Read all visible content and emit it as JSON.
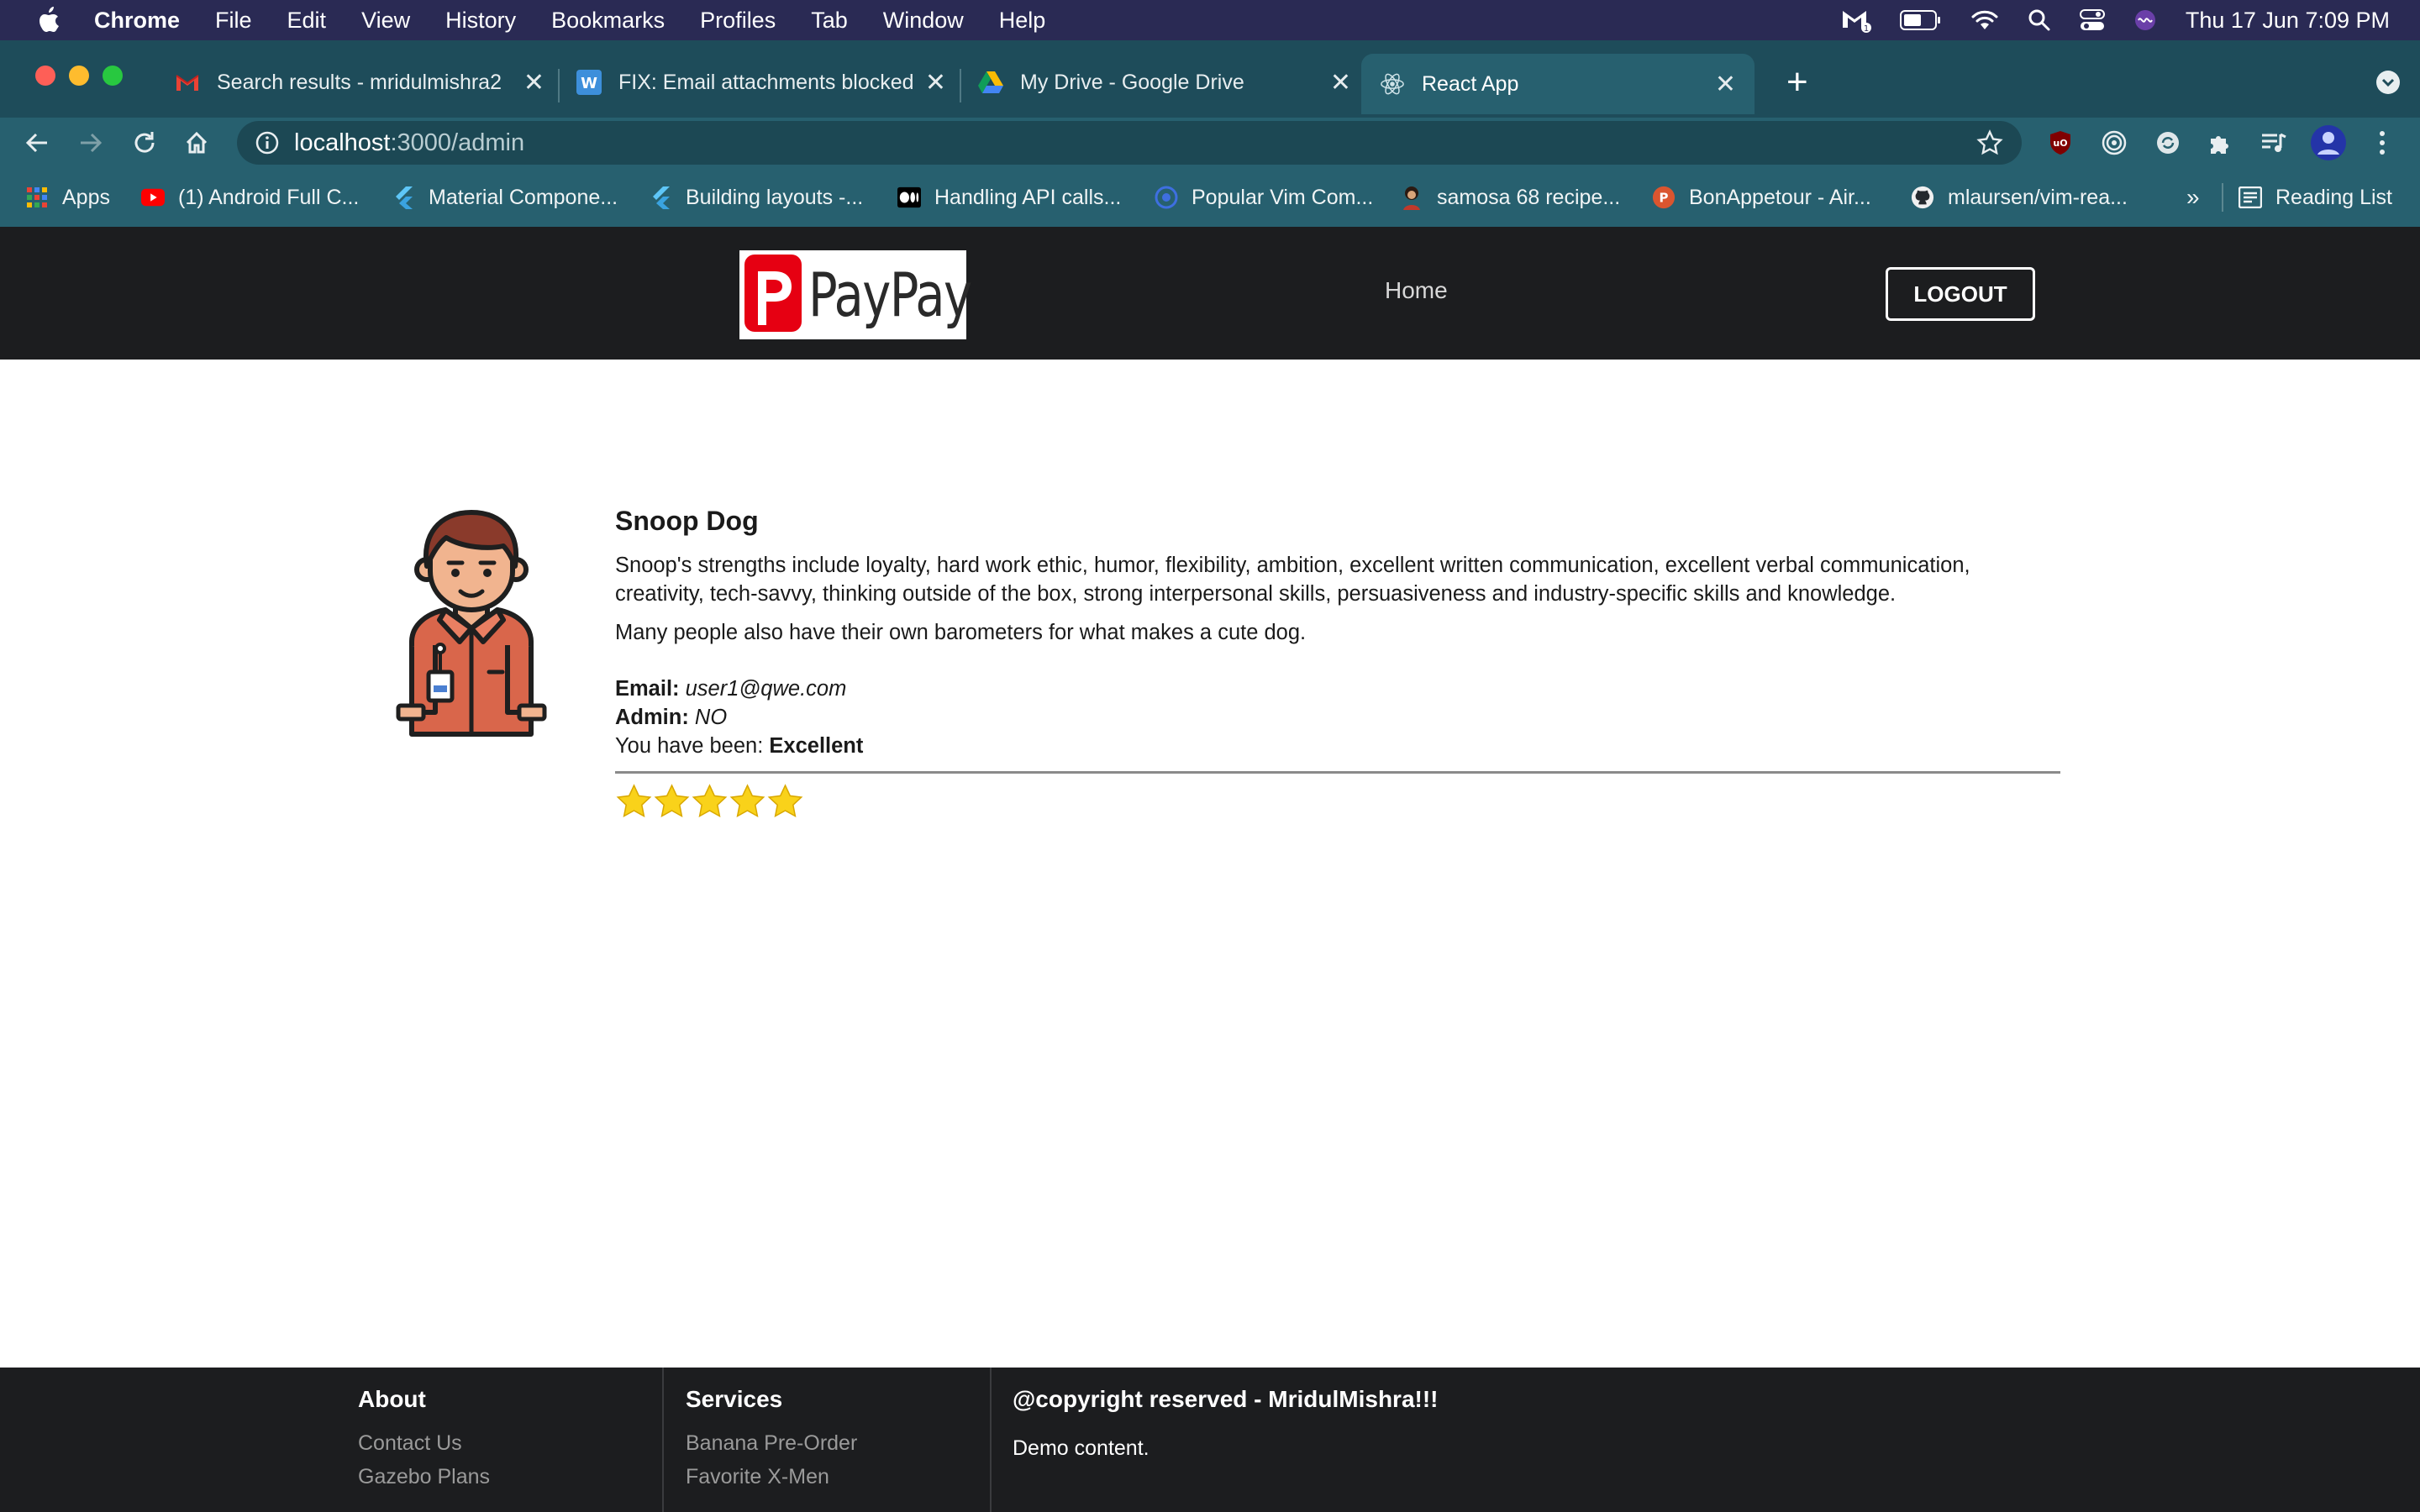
{
  "menubar": {
    "app_name": "Chrome",
    "items": [
      "File",
      "Edit",
      "View",
      "History",
      "Bookmarks",
      "Profiles",
      "Tab",
      "Window",
      "Help"
    ],
    "clock": "Thu 17 Jun  7:09 PM"
  },
  "tabs": [
    {
      "title": "Search results - mridulmishra2",
      "icon": "gmail-icon"
    },
    {
      "title": "FIX: Email attachments blocked",
      "icon": "windows-report-icon"
    },
    {
      "title": "My Drive - Google Drive",
      "icon": "google-drive-icon"
    },
    {
      "title": "React App",
      "icon": "react-icon",
      "active": true
    }
  ],
  "address_bar": {
    "host": "localhost",
    "path": ":3000/admin"
  },
  "bookmarks": {
    "apps_label": "Apps",
    "items": [
      {
        "label": "(1) Android Full C...",
        "icon": "youtube-icon"
      },
      {
        "label": "Material Compone...",
        "icon": "flutter-icon"
      },
      {
        "label": "Building layouts -...",
        "icon": "flutter-icon"
      },
      {
        "label": "Handling API calls...",
        "icon": "medium-icon"
      },
      {
        "label": "Popular Vim Com...",
        "icon": "vim-icon"
      },
      {
        "label": "samosa 68 recipe...",
        "icon": "recipe-icon"
      },
      {
        "label": "BonAppetour - Air...",
        "icon": "producthunt-icon"
      },
      {
        "label": "mlaursen/vim-rea...",
        "icon": "github-icon"
      }
    ],
    "overflow": "»",
    "reading_list": "Reading List"
  },
  "header": {
    "logo_text": "PayPay",
    "home_label": "Home",
    "logout_label": "LOGOUT"
  },
  "profile": {
    "name": "Snoop Dog",
    "strengths": "Snoop's strengths include loyalty, hard work ethic, humor, flexibility, ambition, excellent written communication, excellent verbal communication, creativity, tech-savvy, thinking outside of the box, strong interpersonal skills, persuasiveness and industry-specific skills and knowledge.",
    "note": "Many people also have their own barometers for what makes a cute dog.",
    "email_label": "Email:",
    "email": "user1@qwe.com",
    "admin_label": "Admin:",
    "admin": "NO",
    "rating_label": "You have been:",
    "rating_text": "Excellent",
    "stars": 5,
    "star_color": "#f9d21a"
  },
  "footer": {
    "about": {
      "heading": "About",
      "links": [
        "Contact Us",
        "Gazebo Plans"
      ]
    },
    "services": {
      "heading": "Services",
      "links": [
        "Banana Pre-Order",
        "Favorite X-Men"
      ]
    },
    "copyright": {
      "heading": "@copyright reserved - MridulMishra!!!",
      "text": "Demo content."
    }
  }
}
